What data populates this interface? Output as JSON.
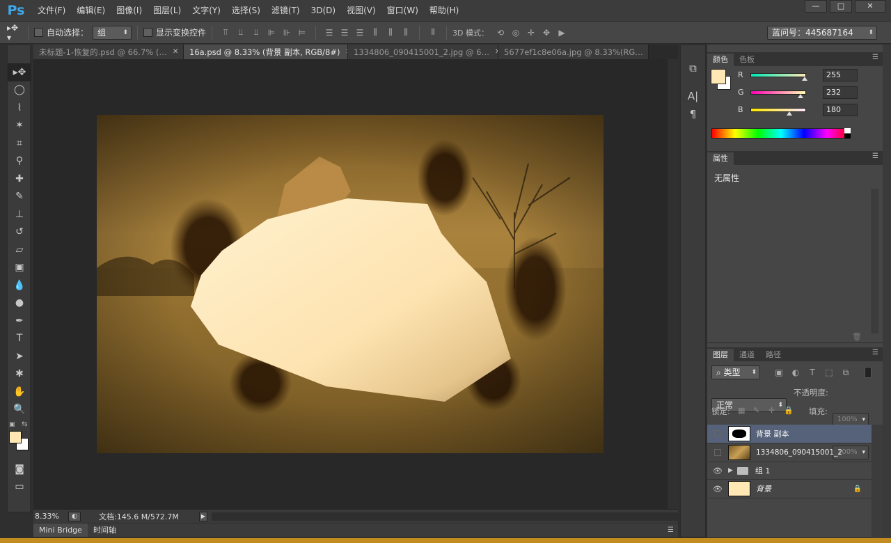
{
  "app": {
    "logo": "Ps"
  },
  "menu": [
    "文件(F)",
    "编辑(E)",
    "图像(I)",
    "图层(L)",
    "文字(Y)",
    "选择(S)",
    "滤镜(T)",
    "3D(D)",
    "视图(V)",
    "窗口(W)",
    "帮助(H)"
  ],
  "window_controls": {
    "minimize": "—",
    "restore": "□",
    "close": "✕"
  },
  "options": {
    "auto_select_label": "自动选择：",
    "auto_select_value": "组",
    "show_transform_label": "显示变换控件",
    "mode3d_label": "3D 模式：",
    "workspace_value": "蓝问号：445687164"
  },
  "doc_tabs": [
    {
      "label": "未标题-1-恢复的.psd @ 66.7% (…",
      "active": false
    },
    {
      "label": "16a.psd @ 8.33% (背景 副本, RGB/8#)",
      "active": true
    },
    {
      "label": "1334806_090415001_2.jpg @ 6…",
      "active": false
    },
    {
      "label": "5677ef1c8e06a.jpg @ 8.33%(RG…",
      "active": false
    }
  ],
  "status": {
    "zoom": "8.33%",
    "doc_info": "文档:145.6 M/572.7M"
  },
  "bottom_tabs": [
    "Mini Bridge",
    "时间轴"
  ],
  "color_panel": {
    "tabs": [
      "颜色",
      "色板"
    ],
    "foreground": "#FFE8B4",
    "r_label": "R",
    "r_value": "255",
    "g_label": "G",
    "g_value": "232",
    "b_label": "B",
    "b_value": "180"
  },
  "properties_panel": {
    "tab": "属性",
    "content": "无属性"
  },
  "layers_panel": {
    "tabs": [
      "图层",
      "通道",
      "路径"
    ],
    "filter_kind": "类型",
    "blend_mode": "正常",
    "opacity_label": "不透明度:",
    "opacity_value": "100%",
    "lock_label": "锁定:",
    "fill_label": "填充:",
    "fill_value": "100%",
    "layers": [
      {
        "name": "背景 副本",
        "visible": false,
        "selected": true,
        "thumb": "mask"
      },
      {
        "name": "1334806_090415001_2",
        "visible": false,
        "selected": false,
        "thumb": "photo"
      },
      {
        "name": "组 1",
        "visible": true,
        "selected": false,
        "thumb": "folder"
      },
      {
        "name": "背景",
        "visible": true,
        "selected": false,
        "thumb": "fill",
        "locked": true
      }
    ]
  },
  "icons": {
    "move": "move-tool-icon",
    "marquee": "ellipse-marquee-icon",
    "lasso": "polygon-lasso-icon",
    "wand": "magic-wand-icon",
    "crop": "crop-icon",
    "eyedropper": "eyedropper-icon",
    "heal": "healing-brush-icon",
    "brush": "brush-icon",
    "stamp": "clone-stamp-icon",
    "history": "history-brush-icon",
    "eraser": "eraser-icon",
    "gradient": "gradient-icon",
    "blur": "blur-icon",
    "dodge": "dodge-icon",
    "pen": "pen-icon",
    "type": "type-icon",
    "path_select": "path-select-icon",
    "shape": "custom-shape-icon",
    "hand": "hand-icon",
    "zoom": "zoom-icon"
  }
}
